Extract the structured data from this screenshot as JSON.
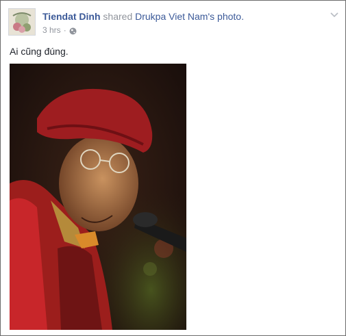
{
  "post": {
    "author": "Tiendat Dinh",
    "action_text": "shared",
    "shared_page": "Drukpa Viet Nam",
    "shared_suffix": "'s photo.",
    "time": "3 hrs",
    "separator": "·",
    "privacy_icon": "globe-icon",
    "menu_icon": "chevron-down-icon",
    "caption": "Ai cũng đúng.",
    "photo_subject": "monk-portrait"
  },
  "colors": {
    "link": "#3b5998",
    "muted": "#90949c",
    "text": "#1d2129",
    "border": "#6b6b6b"
  }
}
